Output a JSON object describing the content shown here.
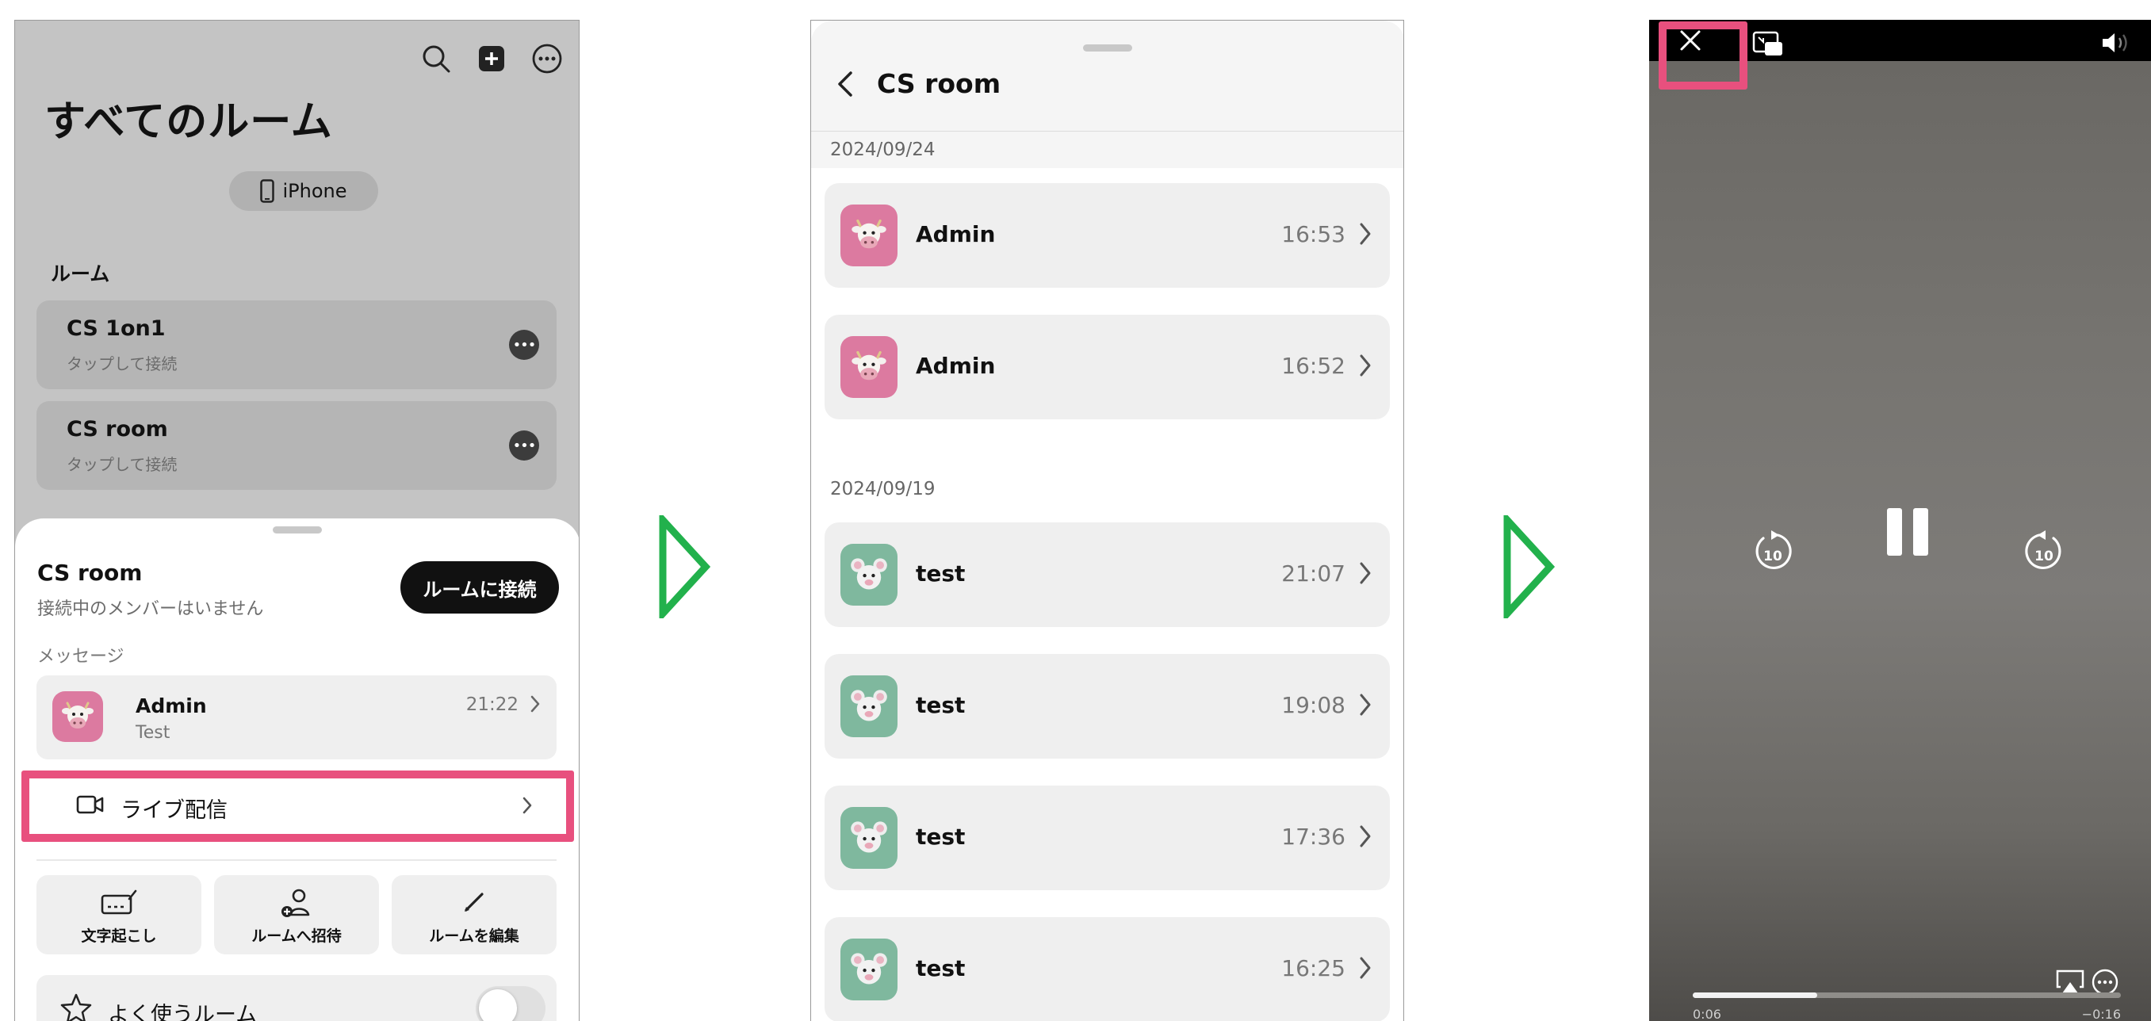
{
  "screen1": {
    "title": "すべてのルーム",
    "device_label": "iPhone",
    "rooms_section_label": "ルーム",
    "rooms": [
      {
        "name": "CS 1on1",
        "subtitle": "タップして接続"
      },
      {
        "name": "CS room",
        "subtitle": "タップして接続"
      }
    ],
    "sheet": {
      "title": "CS room",
      "subtitle": "接続中のメンバーはいません",
      "connect_label": "ルームに接続",
      "messages_label": "メッセージ",
      "message": {
        "sender": "Admin",
        "text": "Test",
        "time": "21:22"
      },
      "live_label": "ライブ配信",
      "actions": [
        "文字起こし",
        "ルームへ招待",
        "ルームを編集"
      ],
      "favorite_label": "よく使うルーム",
      "favorite_on": false
    }
  },
  "screen2": {
    "title": "CS room",
    "groups": [
      {
        "date": "2024/09/24",
        "items": [
          {
            "name": "Admin",
            "time": "16:53",
            "avatar": "cow-emoji"
          },
          {
            "name": "Admin",
            "time": "16:52",
            "avatar": "cow-emoji"
          }
        ]
      },
      {
        "date": "2024/09/19",
        "items": [
          {
            "name": "test",
            "time": "21:07",
            "avatar": "mouse-emoji"
          },
          {
            "name": "test",
            "time": "19:08",
            "avatar": "mouse-emoji"
          },
          {
            "name": "test",
            "time": "17:36",
            "avatar": "mouse-emoji"
          },
          {
            "name": "test",
            "time": "16:25",
            "avatar": "mouse-emoji"
          }
        ]
      }
    ]
  },
  "screen3": {
    "elapsed": "0:06",
    "remaining": "−0:16",
    "progress": 0.29,
    "skip_back_seconds": "10",
    "skip_forward_seconds": "10"
  },
  "colors": {
    "highlight": "#e8507e",
    "arrow": "#22b14c",
    "avatar_pink": "#dc7aa0",
    "avatar_green": "#7fb89e"
  }
}
